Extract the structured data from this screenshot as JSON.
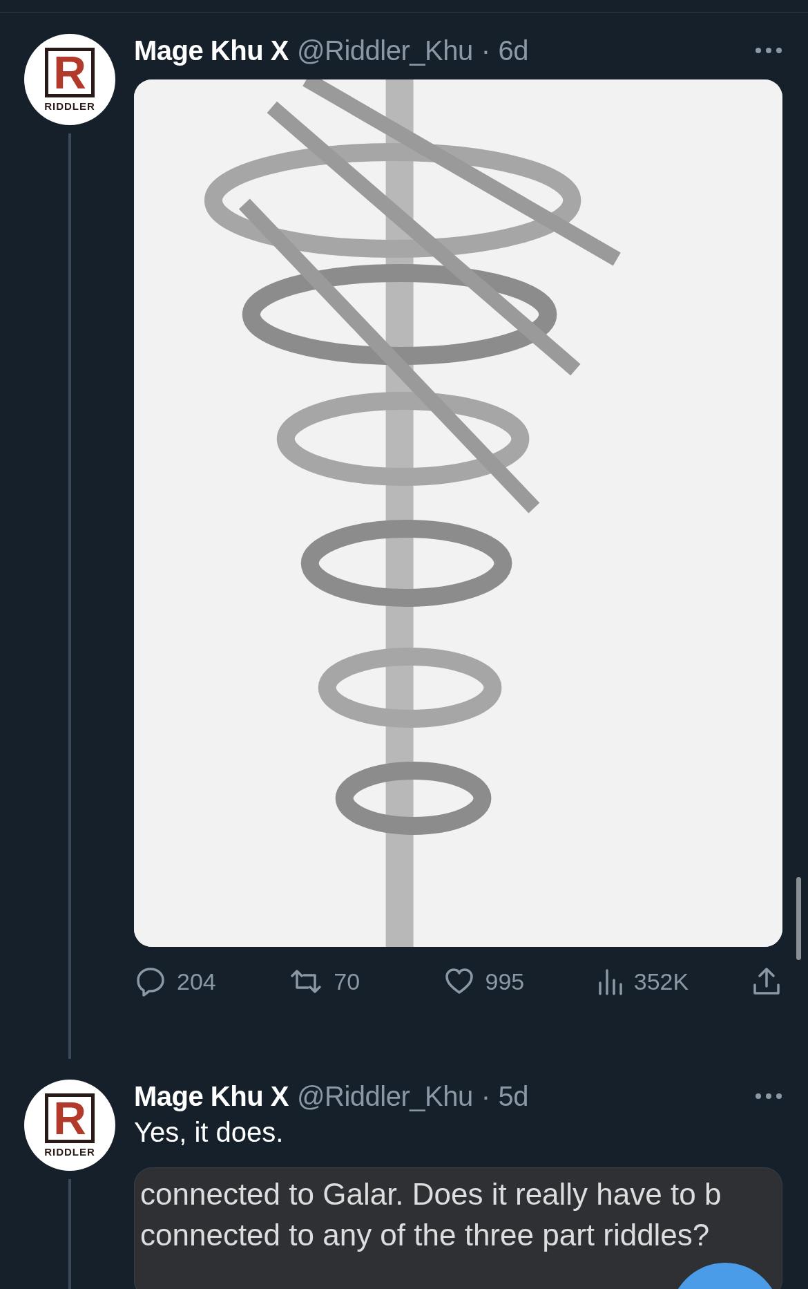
{
  "tweets": [
    {
      "avatar": {
        "letter": "R",
        "caption": "RIDDLER"
      },
      "name": "Mage Khu X",
      "handle": "@Riddler_Khu",
      "dot": "·",
      "time": "6d",
      "actions": [
        {
          "kind": "reply",
          "count": "204"
        },
        {
          "kind": "retweet",
          "count": "70"
        },
        {
          "kind": "like",
          "count": "995"
        },
        {
          "kind": "views",
          "count": "352K"
        },
        {
          "kind": "share"
        }
      ]
    },
    {
      "avatar": {
        "letter": "R",
        "caption": "RIDDLER"
      },
      "name": "Mage Khu X",
      "handle": "@Riddler_Khu",
      "dot": "·",
      "time": "5d",
      "text": "Yes, it does.",
      "screenshot": [
        "connected to Galar. Does it really have to b",
        "connected to any of the three part riddles?"
      ]
    }
  ]
}
